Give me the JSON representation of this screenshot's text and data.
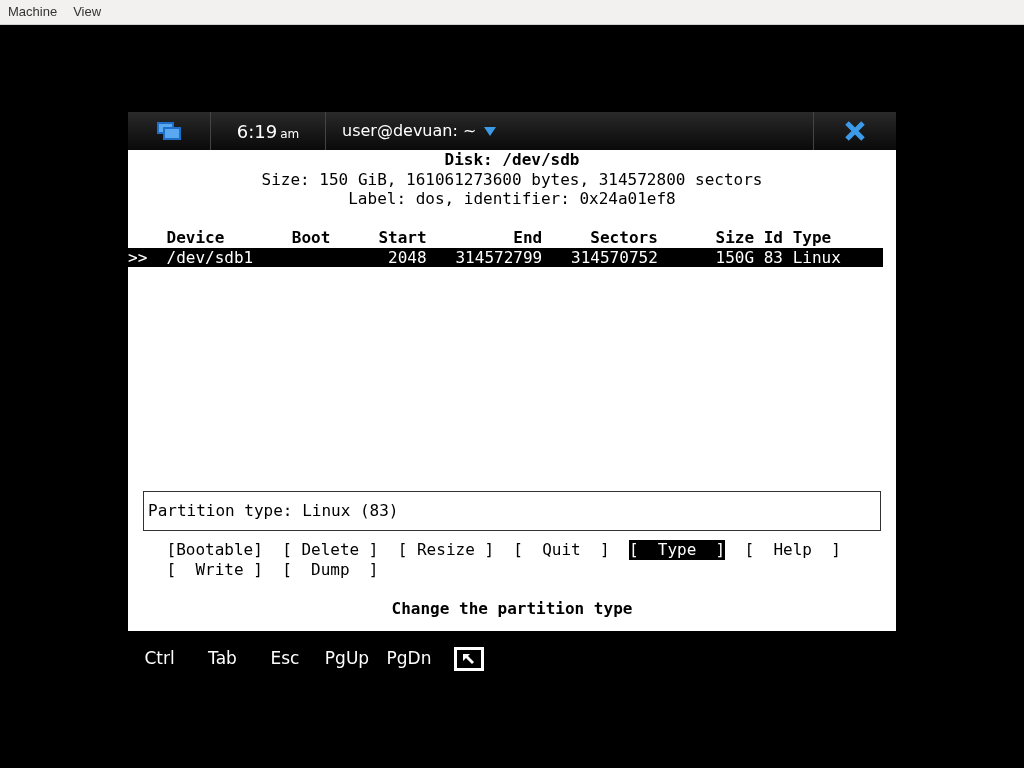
{
  "menu_bar": [
    "Machine",
    "View"
  ],
  "top_bar": {
    "time": "6:19",
    "meridiem": "am",
    "title": "user@devuan: ~"
  },
  "terminal": {
    "header_lines": [
      "Disk: /dev/sdb",
      "Size: 150 GiB, 161061273600 bytes, 314572800 sectors",
      "Label: dos, identifier: 0x24a01ef8"
    ],
    "table": {
      "columns": [
        "Device",
        "Boot",
        "Start",
        "End",
        "Sectors",
        "Size",
        "Id",
        "Type"
      ],
      "rows": [
        {
          "pointer": ">>",
          "selected": true,
          "cells": [
            "/dev/sdb1",
            "",
            "2048",
            "314572799",
            "314570752",
            "150G",
            "83",
            "Linux"
          ]
        }
      ]
    },
    "info_box": "Partition type: Linux (83)",
    "actions": [
      {
        "label": "[Bootable]",
        "selected": false
      },
      {
        "label": "[ Delete ]",
        "selected": false
      },
      {
        "label": "[ Resize ]",
        "selected": false
      },
      {
        "label": "[  Quit  ]",
        "selected": false
      },
      {
        "label": "[  Type  ]",
        "selected": true
      },
      {
        "label": "[  Help  ]",
        "selected": false
      },
      {
        "label": "[  Write ]",
        "selected": false
      },
      {
        "label": "[  Dump  ]",
        "selected": false
      }
    ],
    "status": "Change the partition type"
  },
  "keys": [
    "Ctrl",
    "Tab",
    "Esc",
    "PgUp",
    "PgDn"
  ]
}
